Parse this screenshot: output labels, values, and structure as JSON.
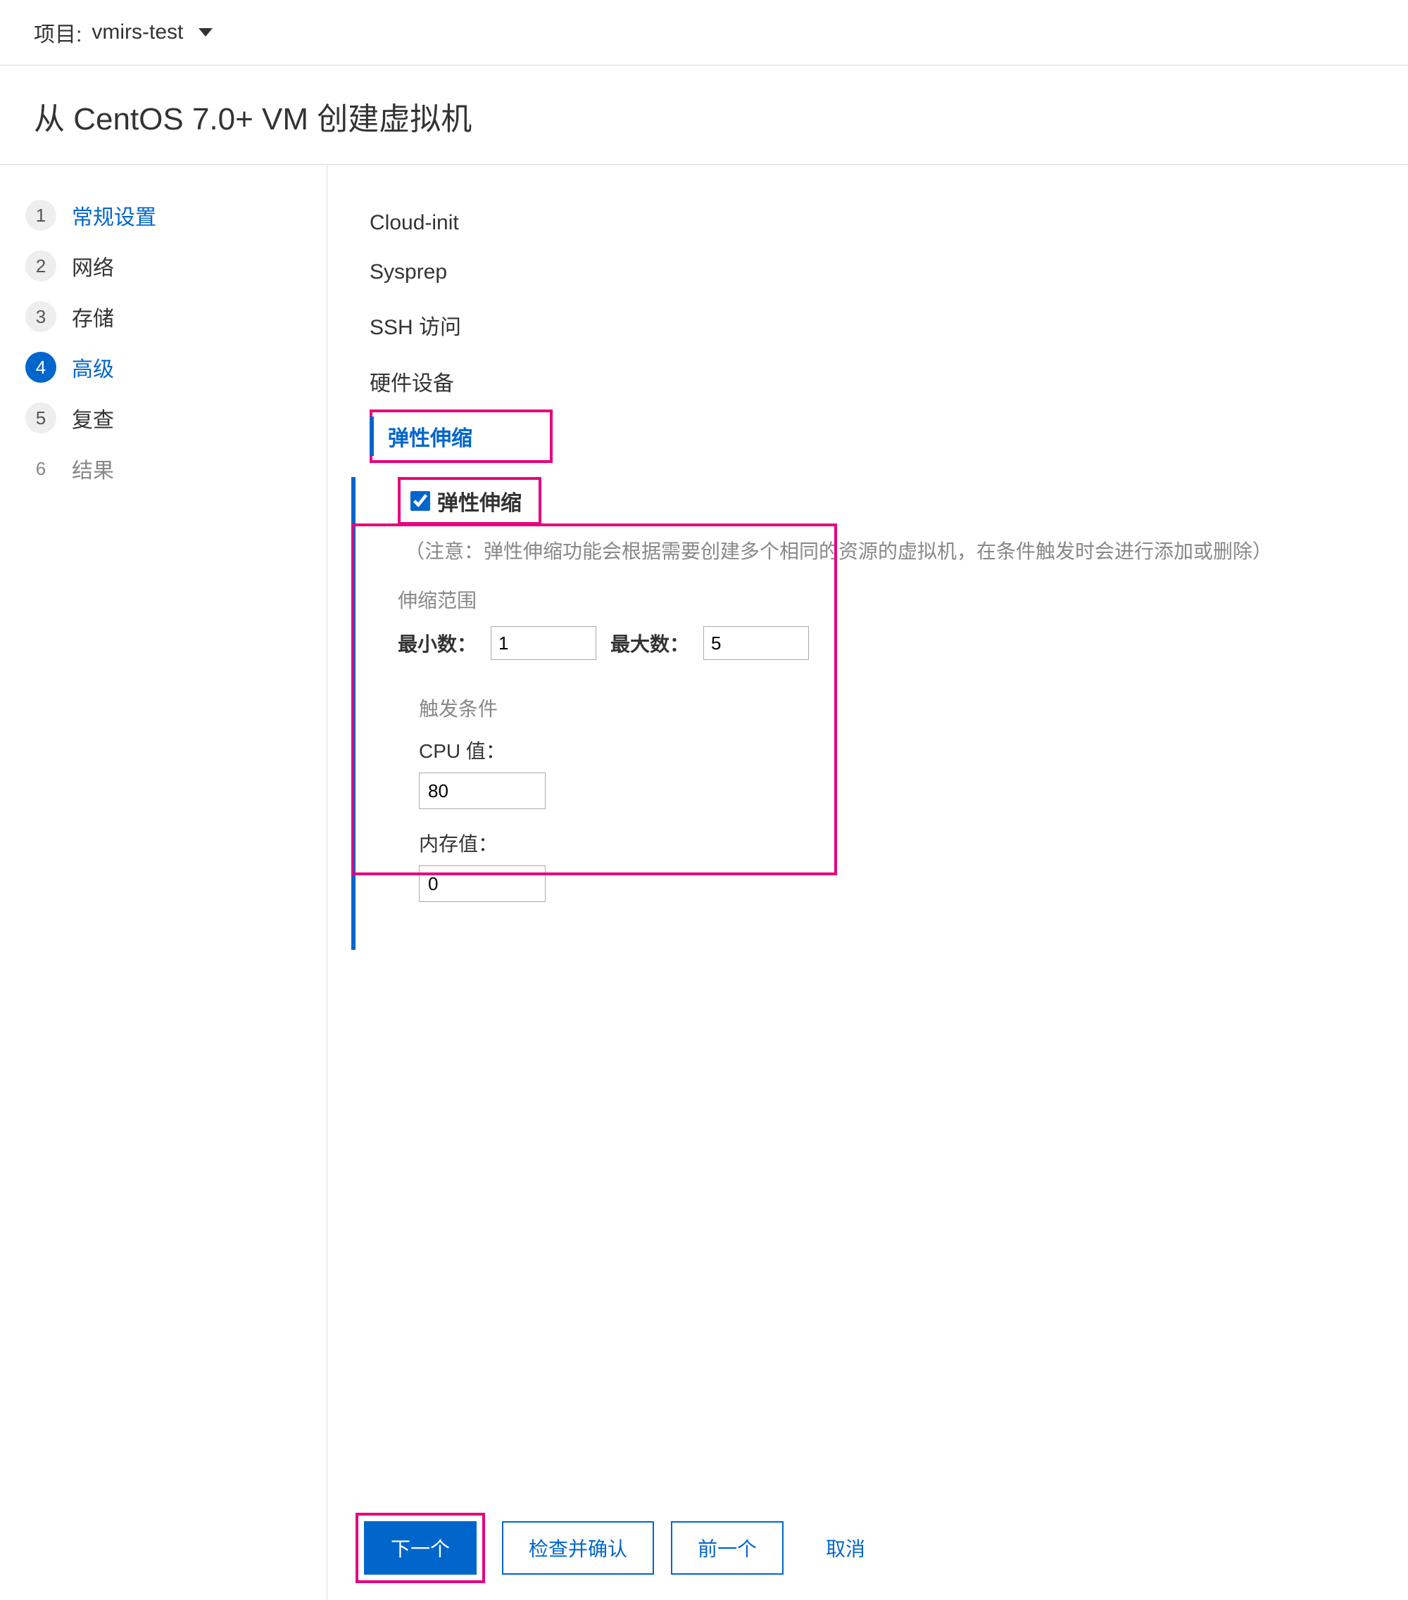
{
  "topbar": {
    "project_label": "项目:",
    "project_name": "vmirs-test"
  },
  "page_title": "从 CentOS 7.0+ VM 创建虚拟机",
  "steps": [
    {
      "num": "1",
      "label": "常规设置",
      "state": "link"
    },
    {
      "num": "2",
      "label": "网络",
      "state": ""
    },
    {
      "num": "3",
      "label": "存储",
      "state": ""
    },
    {
      "num": "4",
      "label": "高级",
      "state": "active"
    },
    {
      "num": "5",
      "label": "复查",
      "state": ""
    },
    {
      "num": "6",
      "label": "结果",
      "state": "disabled"
    }
  ],
  "tabs": {
    "cloud_init": "Cloud-init",
    "sysprep": "Sysprep",
    "ssh": "SSH 访问",
    "hardware": "硬件设备",
    "elastic": "弹性伸缩"
  },
  "elastic": {
    "checkbox_label": "弹性伸缩",
    "checkbox_checked": true,
    "hint": "（注意：弹性伸缩功能会根据需要创建多个相同的资源的虚拟机，在条件触发时会进行添加或删除）",
    "range_title": "伸缩范围",
    "min_label": "最小数：",
    "min_value": "1",
    "max_label": "最大数：",
    "max_value": "5",
    "trigger_title": "触发条件",
    "cpu_label": "CPU 值：",
    "cpu_value": "80",
    "mem_label": "内存值：",
    "mem_value": "0"
  },
  "buttons": {
    "next": "下一个",
    "review": "检查并确认",
    "prev": "前一个",
    "cancel": "取消"
  }
}
